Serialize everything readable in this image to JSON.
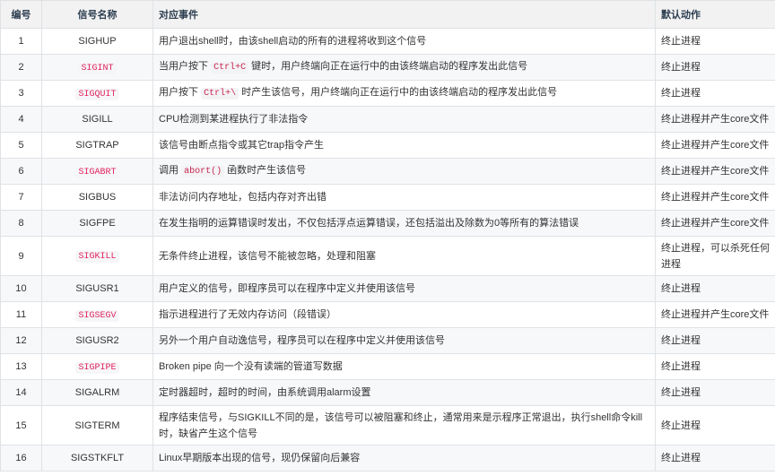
{
  "table": {
    "headers": [
      "编号",
      "信号名称",
      "对应事件",
      "默认动作"
    ],
    "rows": [
      {
        "num": "1",
        "name": "SIGHUP",
        "name_code": false,
        "event_parts": [
          {
            "t": "用户退出shell时，由该shell启动的所有的进程将收到这个信号"
          }
        ],
        "action": "终止进程"
      },
      {
        "num": "2",
        "name": "SIGINT",
        "name_code": true,
        "event_parts": [
          {
            "t": "当用户按下 "
          },
          {
            "t": "Ctrl+C",
            "code": true
          },
          {
            "t": " 键时，用户终端向正在运行中的由该终端启动的程序发出此信号"
          }
        ],
        "action": "终止进程"
      },
      {
        "num": "3",
        "name": "SIGQUIT",
        "name_code": true,
        "event_parts": [
          {
            "t": "用户按下 "
          },
          {
            "t": "Ctrl+\\",
            "code": true
          },
          {
            "t": " 时产生该信号，用户终端向正在运行中的由该终端启动的程序发出此信号"
          }
        ],
        "action": "终止进程"
      },
      {
        "num": "4",
        "name": "SIGILL",
        "name_code": false,
        "event_parts": [
          {
            "t": "CPU检测到某进程执行了非法指令"
          }
        ],
        "action": "终止进程并产生core文件"
      },
      {
        "num": "5",
        "name": "SIGTRAP",
        "name_code": false,
        "event_parts": [
          {
            "t": "该信号由断点指令或其它trap指令产生"
          }
        ],
        "action": "终止进程并产生core文件"
      },
      {
        "num": "6",
        "name": "SIGABRT",
        "name_code": true,
        "event_parts": [
          {
            "t": "调用 "
          },
          {
            "t": "abort()",
            "code": true
          },
          {
            "t": " 函数时产生该信号"
          }
        ],
        "action": "终止进程并产生core文件"
      },
      {
        "num": "7",
        "name": "SIGBUS",
        "name_code": false,
        "event_parts": [
          {
            "t": "非法访问内存地址，包括内存对齐出错"
          }
        ],
        "action": "终止进程并产生core文件"
      },
      {
        "num": "8",
        "name": "SIGFPE",
        "name_code": false,
        "event_parts": [
          {
            "t": "在发生指明的运算错误时发出，不仅包括浮点运算错误，还包括溢出及除数为0等所有的算法错误"
          }
        ],
        "action": "终止进程并产生core文件"
      },
      {
        "num": "9",
        "name": "SIGKILL",
        "name_code": true,
        "tall": true,
        "event_parts": [
          {
            "t": "无条件终止进程，该信号不能被忽略，处理和阻塞"
          }
        ],
        "action": "终止进程，可以杀死任何进程"
      },
      {
        "num": "10",
        "name": "SIGUSR1",
        "name_code": false,
        "event_parts": [
          {
            "t": "用户定义的信号，即程序员可以在程序中定义并使用该信号"
          }
        ],
        "action": "终止进程"
      },
      {
        "num": "11",
        "name": "SIGSEGV",
        "name_code": true,
        "event_parts": [
          {
            "t": "指示进程进行了无效内存访问（段错误）"
          }
        ],
        "action": "终止进程并产生core文件"
      },
      {
        "num": "12",
        "name": "SIGUSR2",
        "name_code": false,
        "event_parts": [
          {
            "t": "另外一个用户自动逸信号，程序员可以在程序中定义并使用该信号"
          }
        ],
        "action": "终止进程"
      },
      {
        "num": "13",
        "name": "SIGPIPE",
        "name_code": true,
        "event_parts": [
          {
            "t": "Broken pipe 向一个没有读端的管道写数据"
          }
        ],
        "action": "终止进程"
      },
      {
        "num": "14",
        "name": "SIGALRM",
        "name_code": false,
        "event_parts": [
          {
            "t": "定时器超时，超时的时间，由系统调用alarm设置"
          }
        ],
        "action": "终止进程"
      },
      {
        "num": "15",
        "name": "SIGTERM",
        "name_code": false,
        "tall": true,
        "event_parts": [
          {
            "t": "程序结束信号，与SIGKILL不同的是，该信号可以被阻塞和终止，通常用来是示程序正常退出，执行shell命令kill时，缺省产生这个信号"
          }
        ],
        "action": "终止进程"
      },
      {
        "num": "16",
        "name": "SIGSTKFLT",
        "name_code": false,
        "event_parts": [
          {
            "t": "Linux早期版本出现的信号，现仍保留向后兼容"
          }
        ],
        "action": "终止进程"
      }
    ]
  }
}
